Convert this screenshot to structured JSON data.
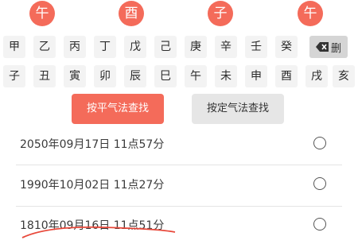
{
  "pillars": [
    "午",
    "酉",
    "子",
    "午"
  ],
  "stems": [
    "甲",
    "乙",
    "丙",
    "丁",
    "戊",
    "己",
    "庚",
    "辛",
    "壬",
    "癸"
  ],
  "branches": [
    "子",
    "丑",
    "寅",
    "卯",
    "辰",
    "巳",
    "午",
    "未",
    "申",
    "酉",
    "戌",
    "亥"
  ],
  "delete_key": {
    "label": "删",
    "icon": "backspace-icon"
  },
  "buttons": {
    "primary": "按平气法查找",
    "secondary": "按定气法查找"
  },
  "results": [
    {
      "text": "2050年09月17日 11点57分"
    },
    {
      "text": "1990年10月02日 11点27分"
    },
    {
      "text": "1810年09月16日 11点51分"
    }
  ],
  "colors": {
    "accent": "#f46b5a",
    "key_bg": "#f3f3f3",
    "secondary_btn": "#e6e6e6"
  }
}
